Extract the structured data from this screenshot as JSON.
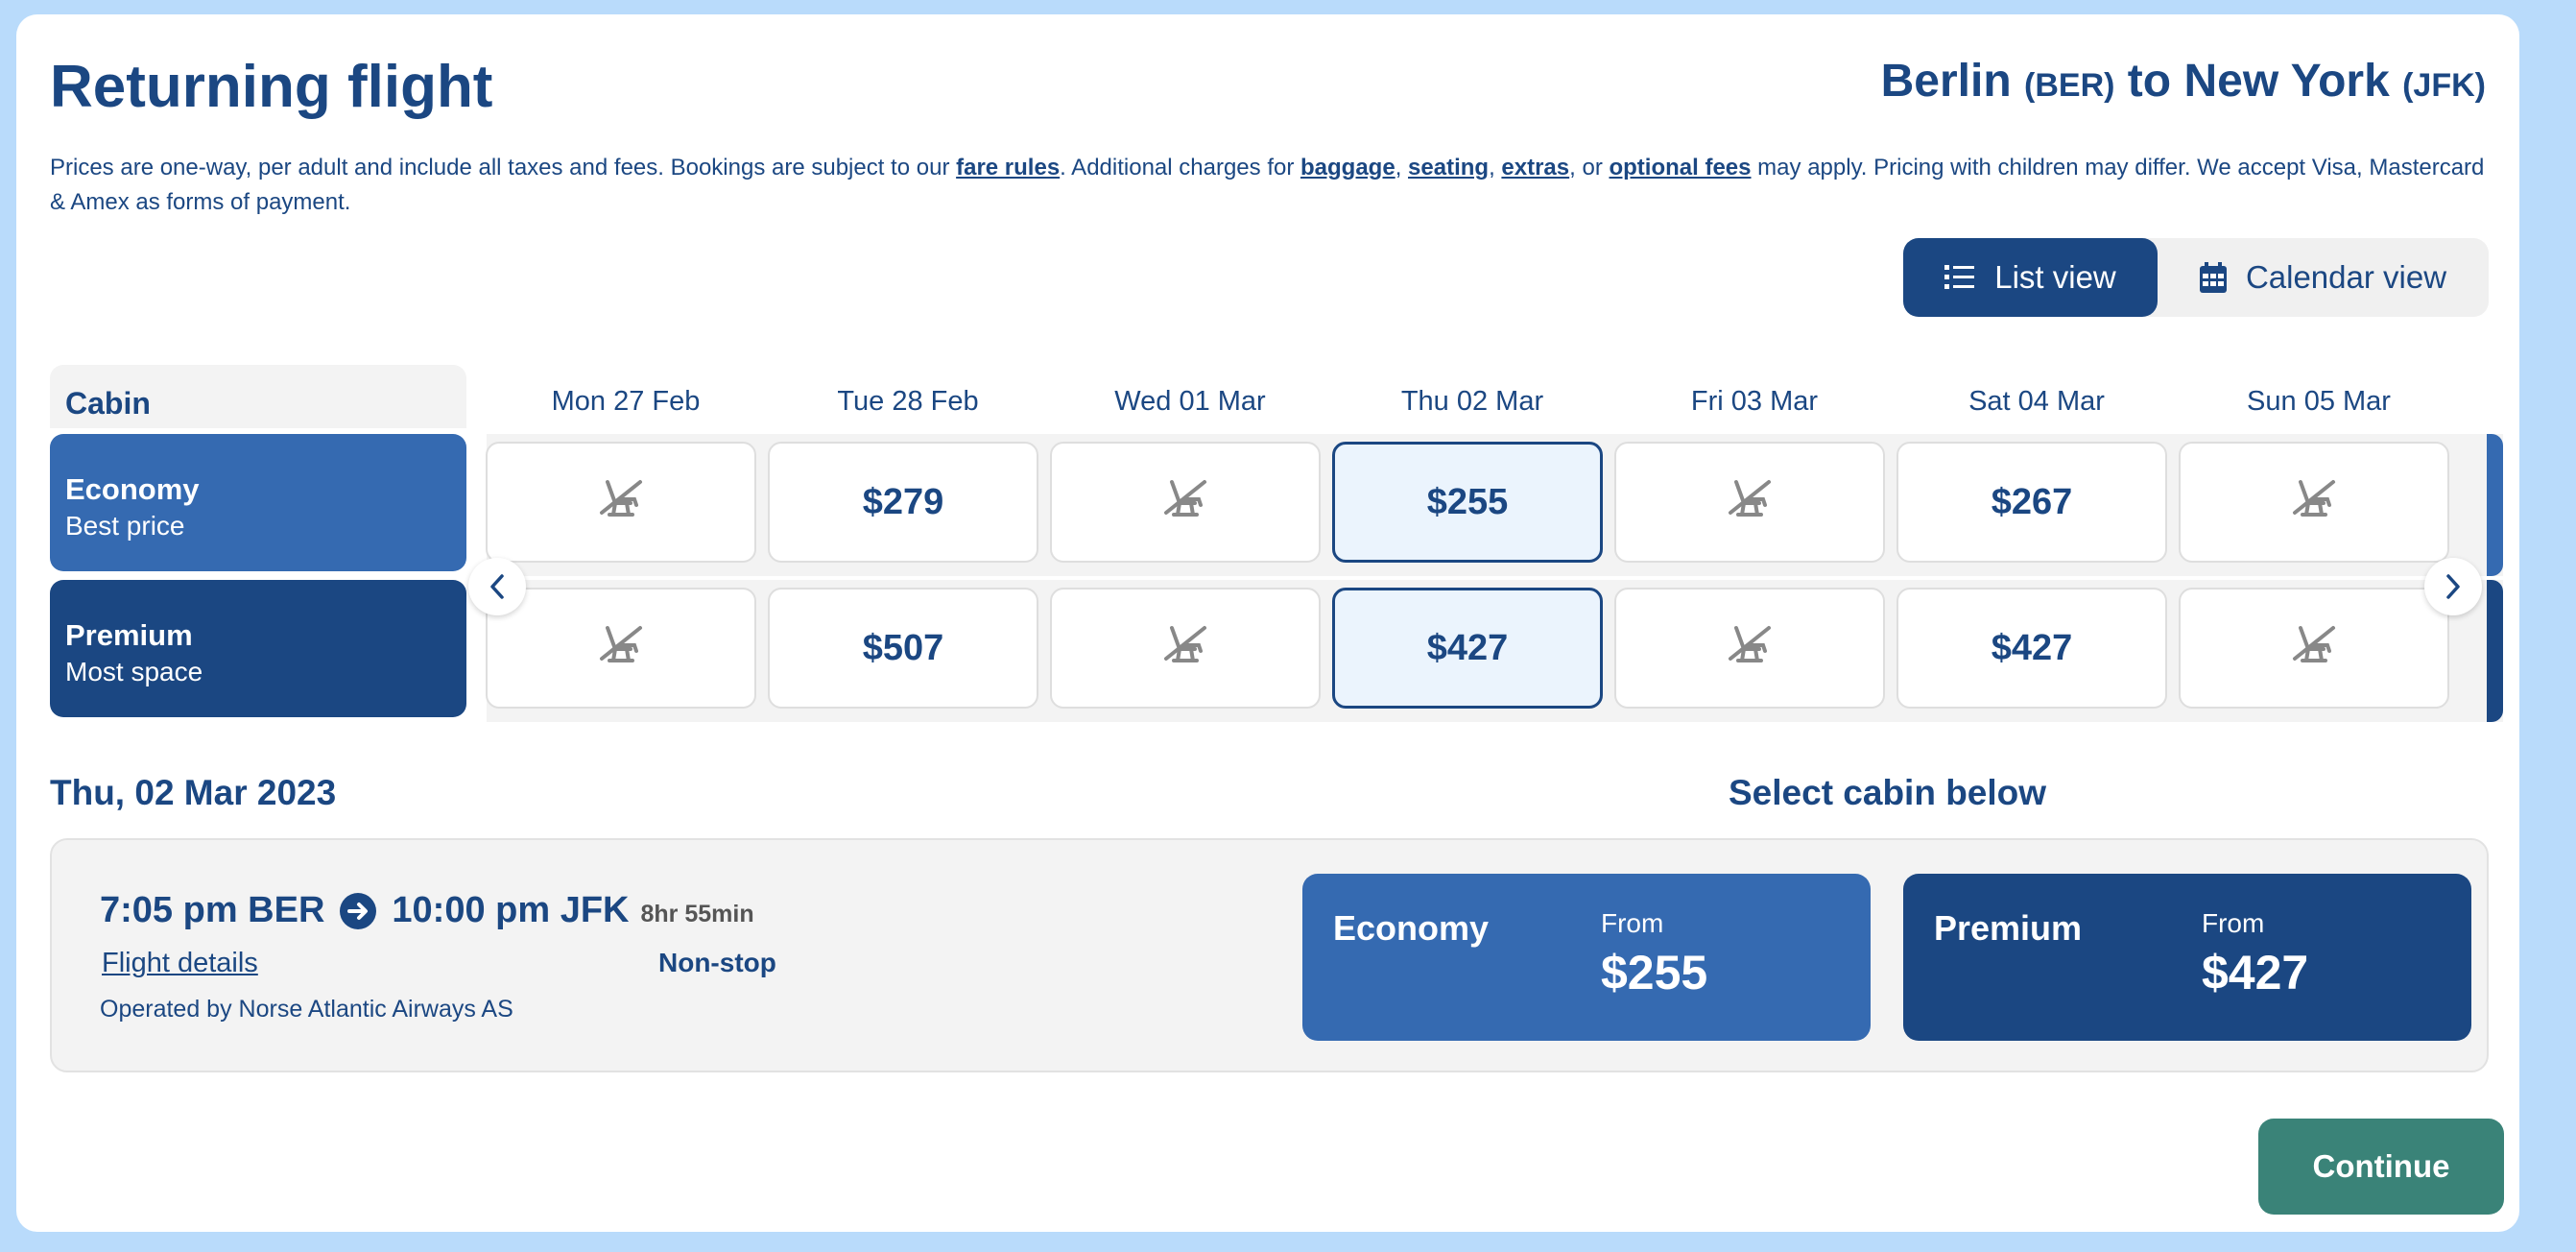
{
  "header": {
    "title": "Returning flight",
    "route": {
      "origin": "Berlin",
      "origin_code": "(BER)",
      "connector": "to",
      "destination": "New York",
      "destination_code": "(JFK)"
    }
  },
  "notice": {
    "text1": "Prices are one-way, per adult and include all taxes and fees. Bookings are subject to our ",
    "link_fare_rules": "fare rules",
    "text2": ". Additional charges for ",
    "link_baggage": "baggage",
    "sep1": ", ",
    "link_seating": "seating",
    "sep2": ", ",
    "link_extras": "extras",
    "sep3": ", or ",
    "link_optional_fees": "optional fees",
    "text3": " may apply. Pricing with children may differ. We accept Visa, Mastercard & Amex as forms of payment."
  },
  "view_toggle": {
    "list_label": "List view",
    "calendar_label": "Calendar view",
    "active": "list"
  },
  "grid": {
    "cabin_header": "Cabin",
    "days": [
      "Mon 27 Feb",
      "Tue 28 Feb",
      "Wed 01 Mar",
      "Thu 02 Mar",
      "Fri 03 Mar",
      "Sat 04 Mar",
      "Sun 05 Mar"
    ],
    "selected_day_index": 3,
    "rows": [
      {
        "name": "Economy",
        "sub": "Best price",
        "color": "#356ab1",
        "prices": [
          "",
          "$279",
          "",
          "$255",
          "",
          "$267",
          ""
        ]
      },
      {
        "name": "Premium",
        "sub": "Most space",
        "color": "#1b4782",
        "prices": [
          "",
          "$507",
          "",
          "$427",
          "",
          "$427",
          ""
        ]
      }
    ]
  },
  "selected": {
    "date_heading": "Thu, 02 Mar 2023",
    "select_heading": "Select cabin below"
  },
  "flight": {
    "depart": "7:05 pm BER",
    "arrive": "10:00 pm JFK",
    "duration": "8hr 55min",
    "details_link": "Flight details",
    "stops": "Non-stop",
    "operator": "Operated by Norse Atlantic Airways AS"
  },
  "fares": [
    {
      "name": "Economy",
      "from_label": "From",
      "price": "$255",
      "color": "#356ab1"
    },
    {
      "name": "Premium",
      "from_label": "From",
      "price": "$427",
      "color": "#1b4782"
    }
  ],
  "continue_label": "Continue",
  "colors": {
    "primary": "#1b4782",
    "economy": "#356ab1",
    "continue": "#3a8378",
    "background": "#b9dbfb"
  }
}
